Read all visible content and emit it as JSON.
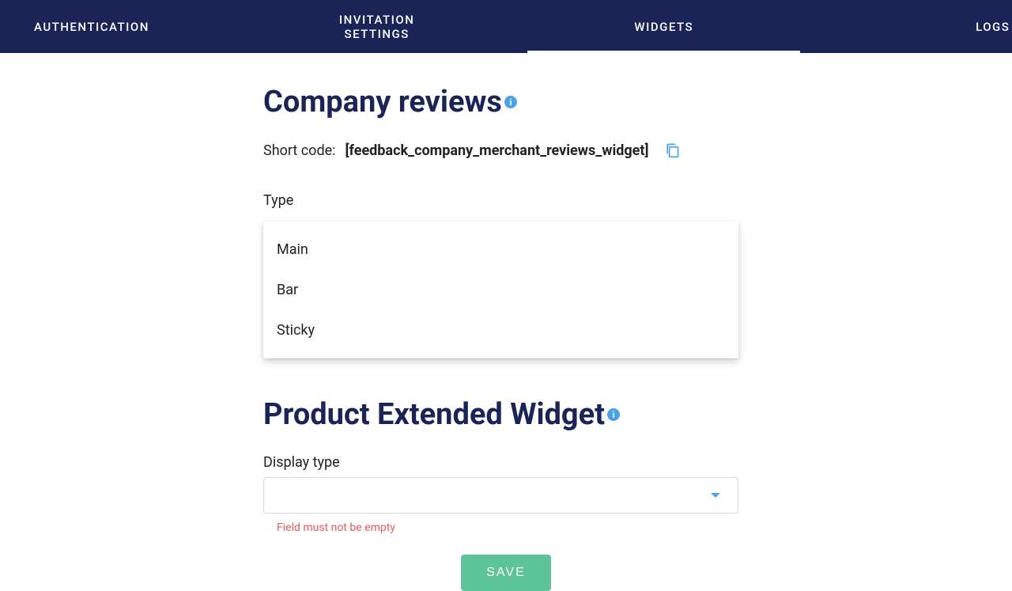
{
  "nav": {
    "auth": "AUTHENTICATION",
    "invitation": "INVITATION SETTINGS",
    "widgets": "WIDGETS",
    "logs": "LOGS"
  },
  "company_reviews": {
    "title": "Company reviews",
    "shortcode_label": "Short code:",
    "shortcode_value": "[feedback_company_merchant_reviews_widget]",
    "type_label": "Type",
    "type_options": [
      "Main",
      "Bar",
      "Sticky"
    ]
  },
  "product_extended": {
    "title": "Product Extended Widget",
    "display_type_label": "Display type",
    "error": "Field must not be empty"
  },
  "save_label": "SAVE"
}
